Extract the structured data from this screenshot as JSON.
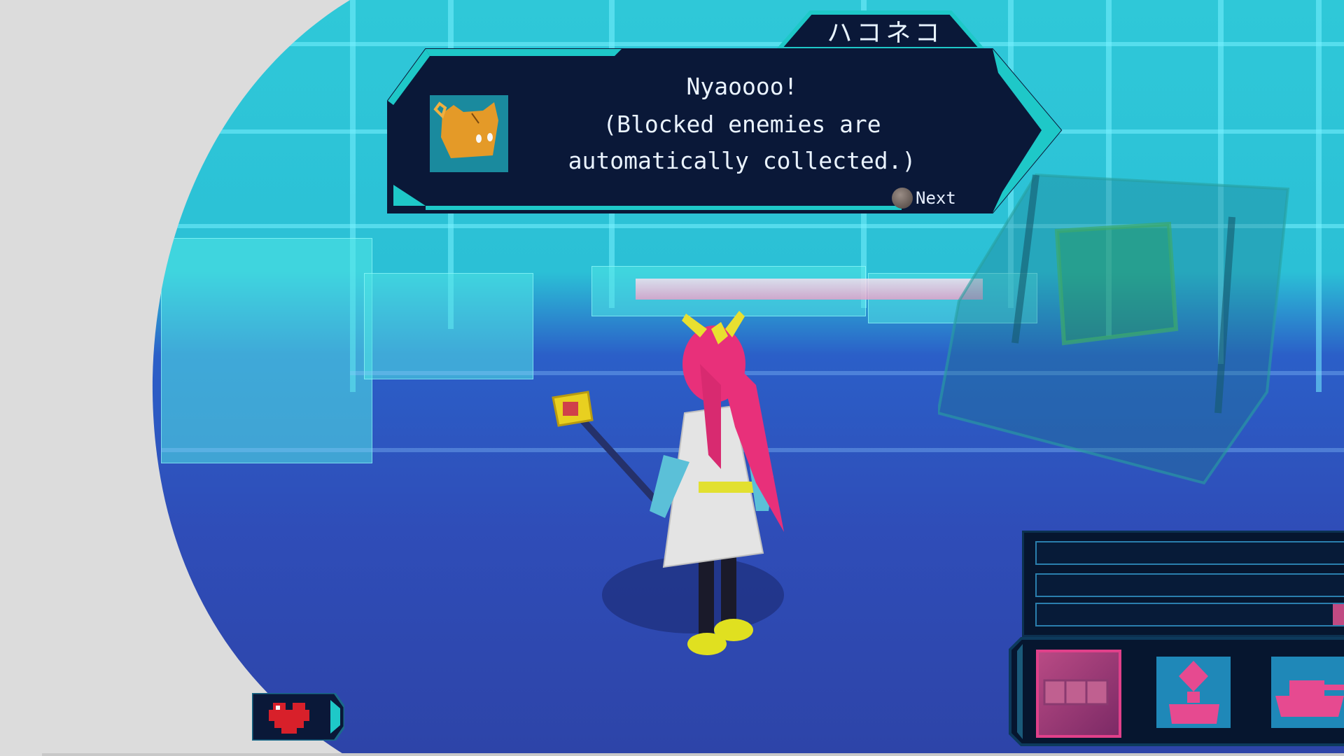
{
  "dialog": {
    "speaker": "ハコネコ",
    "lines": [
      "Nyaoooo!",
      "(Blocked enemies are",
      "automatically collected.)"
    ],
    "next_label": "Next",
    "portrait_icon": "cat-box-icon",
    "next_icon": "confirm-button-icon"
  },
  "hud": {
    "bars": [
      {
        "name": "bar-1",
        "fill": 0
      },
      {
        "name": "bar-2",
        "fill": 0
      },
      {
        "name": "bar-3",
        "fill": 0.08
      }
    ],
    "slots": [
      {
        "name": "block-slot",
        "icon": "block-stack-icon",
        "selected": true
      },
      {
        "name": "turret-slot",
        "icon": "diamond-turret-icon",
        "selected": false
      },
      {
        "name": "tank-slot",
        "icon": "tank-icon",
        "selected": false
      }
    ],
    "health_icon": "pixel-heart-icon"
  },
  "colors": {
    "dialog_bg": "#0a1838",
    "dialog_accent": "#1ec8c8",
    "hair": "#e8307a",
    "slot_selected": "#e0408a"
  }
}
